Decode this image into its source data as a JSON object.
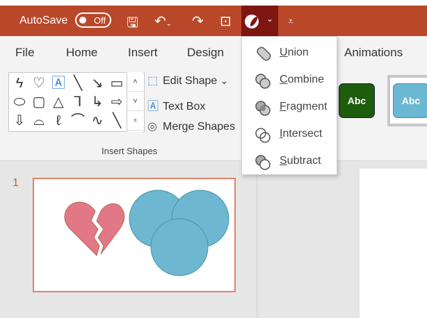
{
  "titlebar": {
    "autosave_label": "AutoSave",
    "toggle_state": "Off",
    "icons": [
      "save-icon",
      "undo-icon",
      "redo-icon",
      "present-icon",
      "merge-shapes-icon",
      "customize-icon"
    ]
  },
  "tabs": [
    {
      "label": "File"
    },
    {
      "label": "Home"
    },
    {
      "label": "Insert"
    },
    {
      "label": "Design"
    },
    {
      "label": "Animations"
    }
  ],
  "ribbon": {
    "edit_shape": "Edit Shape",
    "text_box": "Text Box",
    "merge_shapes": "Merge Shapes",
    "group_label": "Insert Shapes",
    "styles": [
      {
        "label": "Abc",
        "color": "#1e5c0e"
      },
      {
        "label": "Abc",
        "color": "#6ab8d2"
      }
    ]
  },
  "merge_menu": {
    "items": [
      {
        "accel": "U",
        "rest": "nion"
      },
      {
        "accel": "C",
        "rest": "ombine"
      },
      {
        "accel": "F",
        "rest": "ragment"
      },
      {
        "accel": "I",
        "rest": "ntersect"
      },
      {
        "accel": "S",
        "rest": "ubtract"
      }
    ]
  },
  "slides": {
    "number": "1"
  },
  "colors": {
    "accent": "#b9482a",
    "heart": "#e27886",
    "circles": "#6db7d0"
  }
}
